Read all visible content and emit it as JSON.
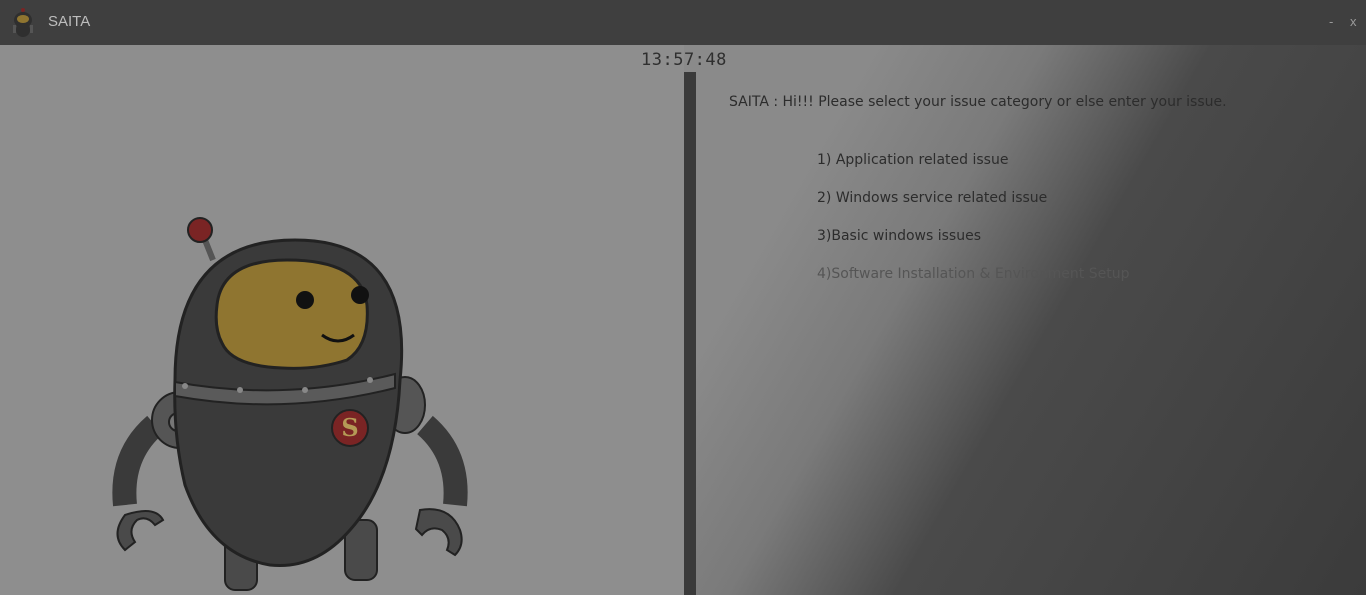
{
  "window": {
    "title": "SAITA",
    "minimize_label": "-",
    "close_label": "x"
  },
  "clock": "13:57:48",
  "chat": {
    "bot_message": "SAITA : Hi!!! Please select your issue category or else enter your issue.",
    "options": [
      "1) Application related issue",
      "2) Windows service related issue",
      "3)Basic windows issues",
      "4)Software Installation & Environment Setup"
    ]
  },
  "robot": {
    "badge_letter": "S"
  },
  "colors": {
    "titlebar": "#3f3f3f",
    "background": "#8e8e8e",
    "divider": "#3a3a3a",
    "robot_body": "#3a3a3a",
    "robot_visor": "#8f7530",
    "badge": "#7a2424"
  }
}
